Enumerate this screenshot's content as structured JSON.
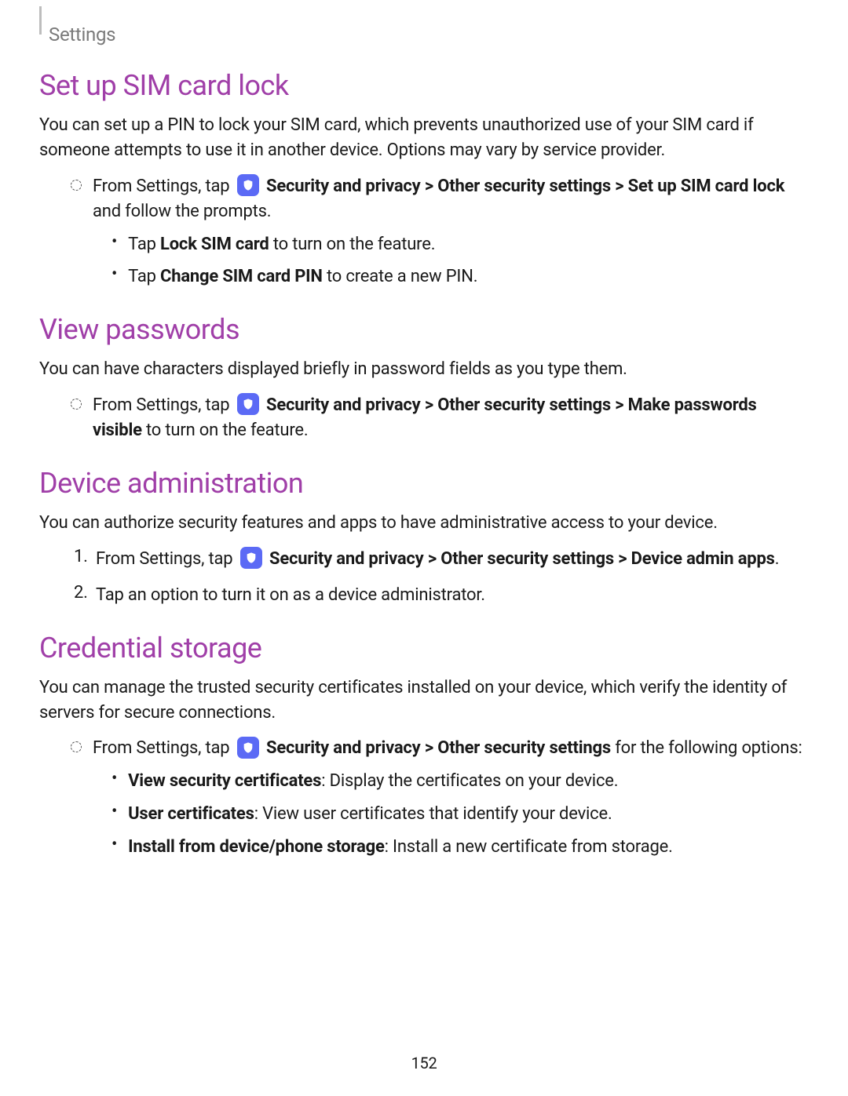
{
  "breadcrumb": "Settings",
  "page_number": "152",
  "sections": {
    "sim": {
      "heading": "Set up SIM card lock",
      "intro": "You can set up a PIN to lock your SIM card, which prevents unauthorized use of your SIM card if someone attempts to use it in another device. Options may vary by service provider.",
      "step_prefix": "From Settings, tap ",
      "step_b1": "Security and privacy",
      "gt1": " > ",
      "step_b2": "Other security settings",
      "gt2": " > ",
      "step_b3": "Set up SIM card lock",
      "step_suffix": " and follow the prompts.",
      "sub1_pre": "Tap ",
      "sub1_b": "Lock SIM card",
      "sub1_post": " to turn on the feature.",
      "sub2_pre": "Tap ",
      "sub2_b": "Change SIM card PIN",
      "sub2_post": " to create a new PIN."
    },
    "pwd": {
      "heading": "View passwords",
      "intro": "You can have characters displayed briefly in password fields as you type them.",
      "step_prefix": "From Settings, tap ",
      "step_b1": "Security and privacy",
      "gt1": " > ",
      "step_b2": "Other security settings",
      "gt2": " > ",
      "step_b3": "Make passwords visible",
      "step_suffix": " to turn on the feature."
    },
    "admin": {
      "heading": "Device administration",
      "intro": "You can authorize security features and apps to have administrative access to your device.",
      "n1": "1.",
      "step1_prefix": "From Settings, tap ",
      "step1_b1": "Security and privacy",
      "gt1": " > ",
      "step1_b2": "Other security settings",
      "gt2": " > ",
      "step1_b3": "Device admin apps",
      "step1_suffix": ".",
      "n2": "2.",
      "step2": "Tap an option to turn it on as a device administrator."
    },
    "cred": {
      "heading": "Credential storage",
      "intro": "You can manage the trusted security certificates installed on your device, which verify the identity of servers for secure connections.",
      "step_prefix": "From Settings, tap ",
      "step_b1": "Security and privacy",
      "gt1": " > ",
      "step_b2": "Other security settings",
      "step_suffix": " for the following options:",
      "sub1_b": "View security certificates",
      "sub1_post": ": Display the certificates on your device.",
      "sub2_b": "User certificates",
      "sub2_post": ": View user certificates that identify your device.",
      "sub3_b": "Install from device/phone storage",
      "sub3_post": ": Install a new certificate from storage."
    }
  }
}
